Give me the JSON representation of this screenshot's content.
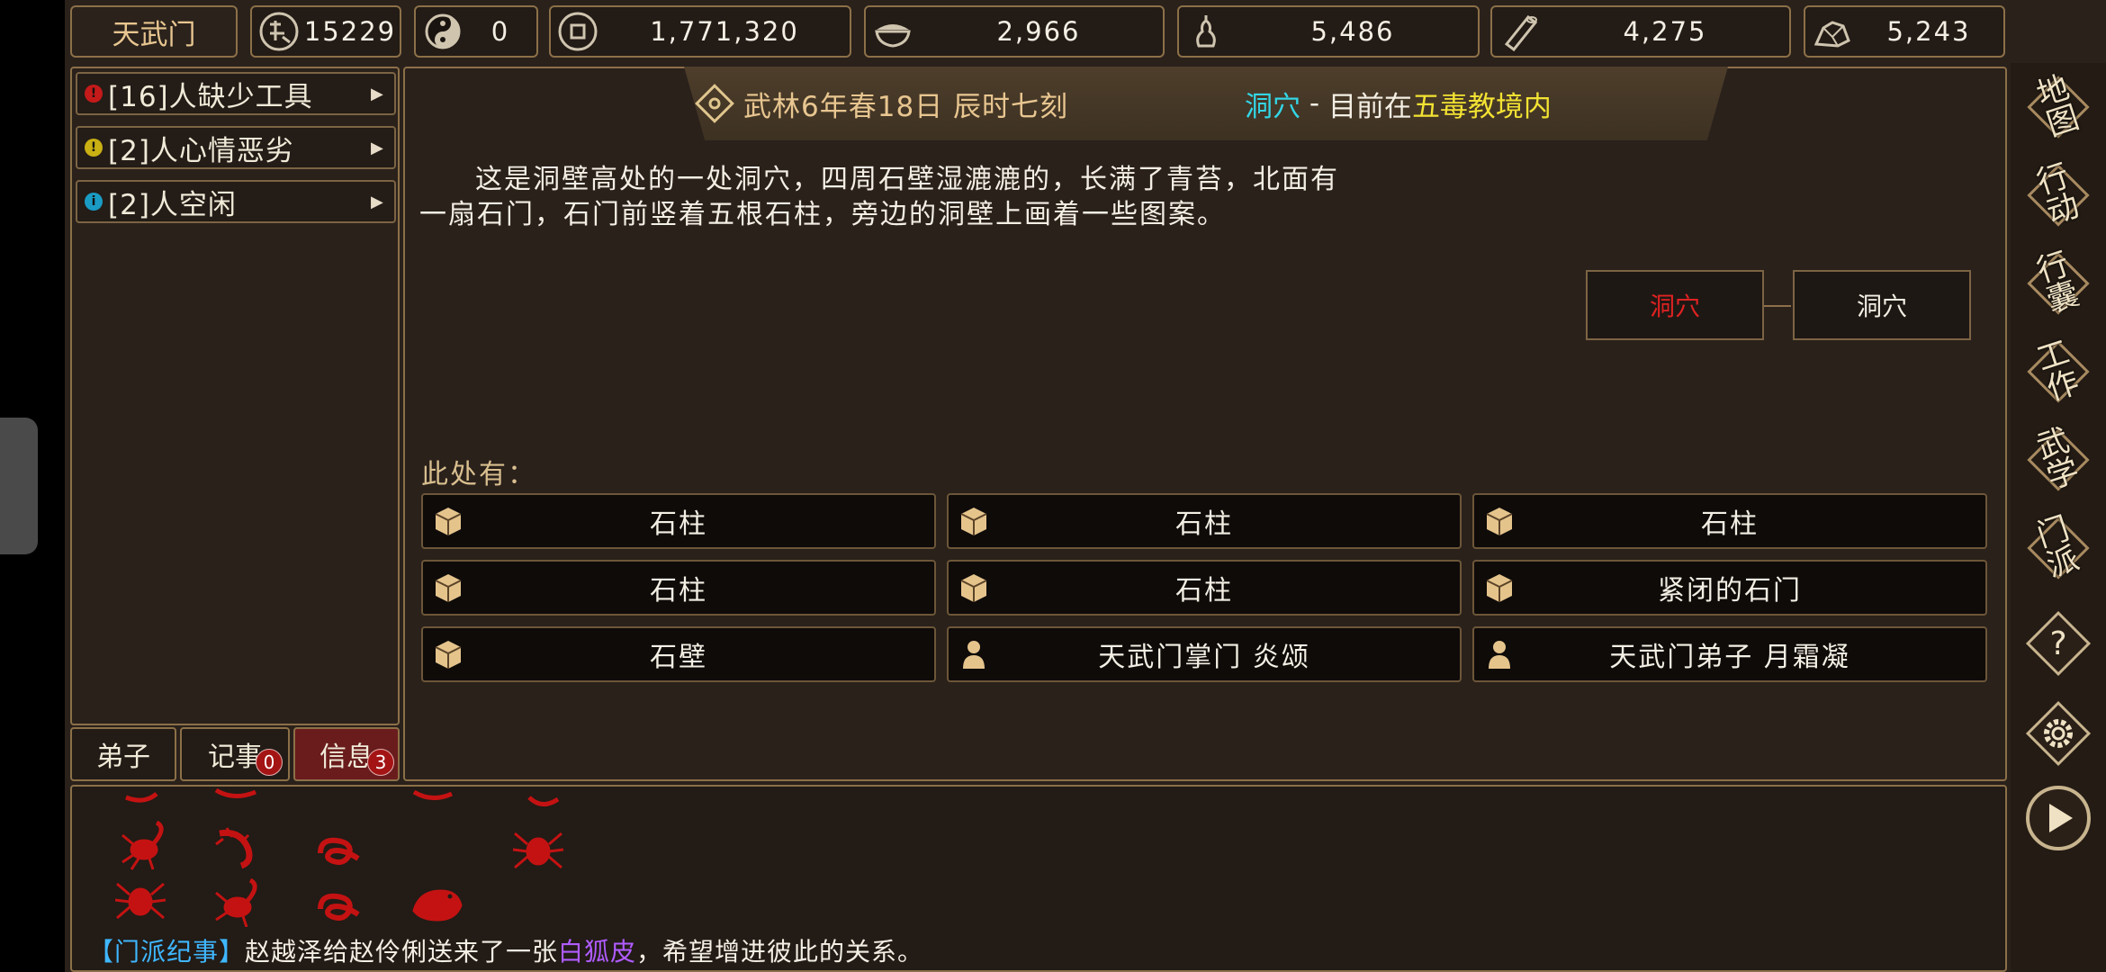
{
  "sect_name": "天武门",
  "resources": [
    {
      "icon": "reputation-icon",
      "value": "15229"
    },
    {
      "icon": "yin-yang-icon",
      "value": "0"
    },
    {
      "icon": "coin-icon",
      "value": "1,771,320"
    },
    {
      "icon": "food-bowl-icon",
      "value": "2,966"
    },
    {
      "icon": "gourd-icon",
      "value": "5,486"
    },
    {
      "icon": "wood-log-icon",
      "value": "4,275"
    },
    {
      "icon": "ore-icon",
      "value": "5,243"
    }
  ],
  "alerts": [
    {
      "text": "[16]人缺少工具",
      "color": "#c41a1a"
    },
    {
      "text": "[2]人心情恶劣",
      "color": "#c9b013"
    },
    {
      "text": "[2]人空闲",
      "color": "#1a9bc4"
    }
  ],
  "tabs": {
    "disciples": "弟子",
    "records": "记事",
    "records_badge": "0",
    "messages": "信息",
    "messages_badge": "3"
  },
  "header": {
    "date": "武林6年春18日 辰时七刻",
    "location": "洞穴",
    "separator": " - ",
    "status_prefix": "目前在",
    "region": "五毒教境内"
  },
  "description": "这是洞壁高处的一处洞穴，四周石壁湿漉漉的，长满了青苔，北面有一扇石门，石门前竖着五根石柱，旁边的洞壁上画着一些图案。",
  "map_nodes": [
    "洞穴",
    "洞穴"
  ],
  "here_label": "此处有：",
  "objects": [
    {
      "type": "item",
      "label": "石柱"
    },
    {
      "type": "item",
      "label": "石柱"
    },
    {
      "type": "item",
      "label": "石柱"
    },
    {
      "type": "item",
      "label": "石柱"
    },
    {
      "type": "item",
      "label": "石柱"
    },
    {
      "type": "item",
      "label": "紧闭的石门"
    },
    {
      "type": "item",
      "label": "石壁"
    },
    {
      "type": "person",
      "label": "天武门掌门 炎颂"
    },
    {
      "type": "person",
      "label": "天武门弟子 月霜凝"
    }
  ],
  "log": {
    "tag": "【门派纪事】",
    "text_before": "赵越泽给赵伶俐送来了一张",
    "item": "白狐皮",
    "text_after": "，希望增进彼此的关系。"
  },
  "colors": {
    "tag": "#3fb7ff",
    "item": "#b05cff",
    "location": "#33d6e6",
    "region": "#f2e233",
    "current_node": "#e02222",
    "creature": "#c41212"
  },
  "sidebar": [
    {
      "label": "地图",
      "icon": "map-icon"
    },
    {
      "label": "行动",
      "icon": "action-icon"
    },
    {
      "label": "行囊",
      "icon": "bag-icon"
    },
    {
      "label": "工作",
      "icon": "work-icon"
    },
    {
      "label": "武学",
      "icon": "martial-arts-icon"
    },
    {
      "label": "门派",
      "icon": "sect-icon"
    },
    {
      "label": "",
      "icon": "help-icon"
    },
    {
      "label": "",
      "icon": "settings-gear-icon"
    },
    {
      "label": "",
      "icon": "play-icon"
    }
  ]
}
